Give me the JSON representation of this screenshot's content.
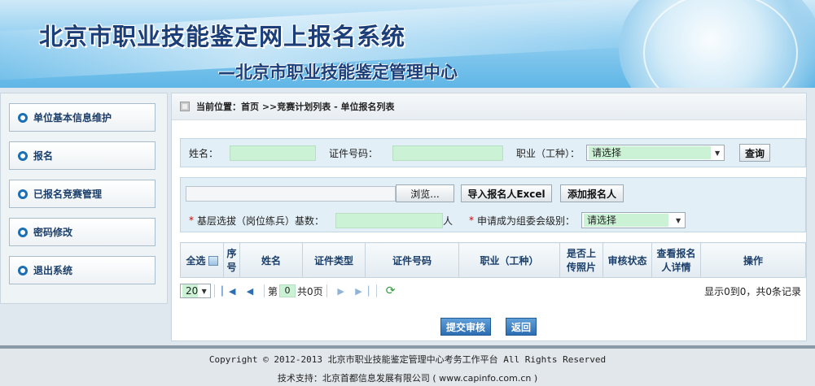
{
  "header": {
    "title": "北京市职业技能鉴定网上报名系统",
    "subtitle": "—北京市职业技能鉴定管理中心"
  },
  "sidebar": {
    "items": [
      {
        "label": "单位基本信息维护"
      },
      {
        "label": "报名"
      },
      {
        "label": "已报名竞赛管理"
      },
      {
        "label": "密码修改"
      },
      {
        "label": "退出系统"
      }
    ]
  },
  "breadcrumb": {
    "text": "当前位置：首页 >>竞赛计划列表 - 单位报名列表"
  },
  "search": {
    "name_label": "姓名：",
    "name_value": "",
    "id_label": "证件号码：",
    "id_value": "",
    "job_label": "职业（工种）：",
    "job_selected": "请选择",
    "query_button": "查询"
  },
  "upload": {
    "file_value": "",
    "browse_button": "浏览...",
    "import_button": "导入报名人Excel",
    "add_button": "添加报名人",
    "base_label": "基层选拔（岗位练兵）基数：",
    "base_value": "",
    "base_unit": "人",
    "level_label": "申请成为组委会级别：",
    "level_selected": "请选择"
  },
  "table": {
    "select_all": "全选",
    "columns": [
      "序号",
      "姓名",
      "证件类型",
      "证件号码",
      "职业（工种）",
      "是否上传照片",
      "审核状态",
      "查看报名人详情",
      "操作"
    ]
  },
  "pager": {
    "page_size": "20",
    "page_prefix": "第",
    "page_number": "0",
    "page_suffix": "共0页",
    "summary": "显示0到0，共0条记录"
  },
  "actions": {
    "submit": "提交审核",
    "back": "返回"
  },
  "footer": {
    "copyright": "Copyright © 2012-2013 北京市职业技能鉴定管理中心考务工作平台 All Rights Reserved",
    "support": "技术支持：北京首都信息发展有限公司 ( www.capinfo.com.cn )"
  },
  "colors": {
    "accent": "#1c3f7a",
    "field_green": "#ccf2d6",
    "panel_blue": "#e3eff6",
    "button_blue": "#2d6eb4"
  }
}
